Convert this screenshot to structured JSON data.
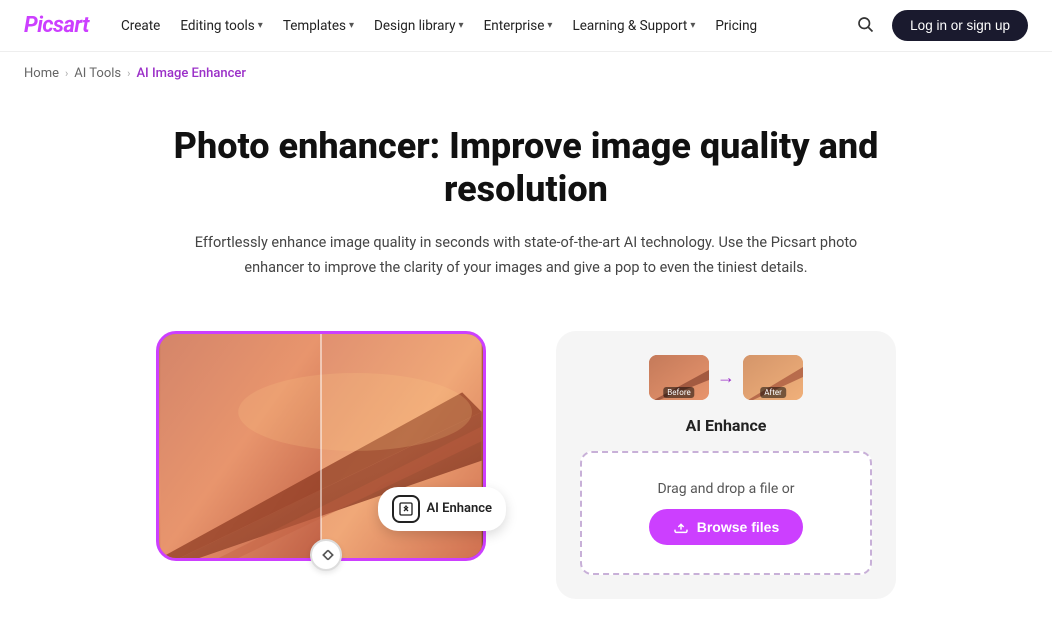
{
  "brand": {
    "name": "Picsart"
  },
  "nav": {
    "links": [
      {
        "label": "Create",
        "hasDropdown": false
      },
      {
        "label": "Editing tools",
        "hasDropdown": true
      },
      {
        "label": "Templates",
        "hasDropdown": true
      },
      {
        "label": "Design library",
        "hasDropdown": true
      },
      {
        "label": "Enterprise",
        "hasDropdown": true
      },
      {
        "label": "Learning & Support",
        "hasDropdown": true
      },
      {
        "label": "Pricing",
        "hasDropdown": false
      }
    ],
    "login_label": "Log in or sign up"
  },
  "breadcrumb": {
    "home": "Home",
    "ai_tools": "AI Tools",
    "current": "AI Image Enhancer"
  },
  "hero": {
    "title": "Photo enhancer: Improve image quality and resolution",
    "description": "Effortlessly enhance image quality in seconds with state-of-the-art AI technology. Use the Picsart photo enhancer to improve the clarity of your images and give a pop to even the tiniest details."
  },
  "upload_panel": {
    "title": "AI Enhance",
    "before_label": "Before",
    "after_label": "After",
    "drop_text": "Drag and drop a file or",
    "browse_label": "Browse files"
  },
  "preview": {
    "badge_label": "AI Enhance"
  }
}
